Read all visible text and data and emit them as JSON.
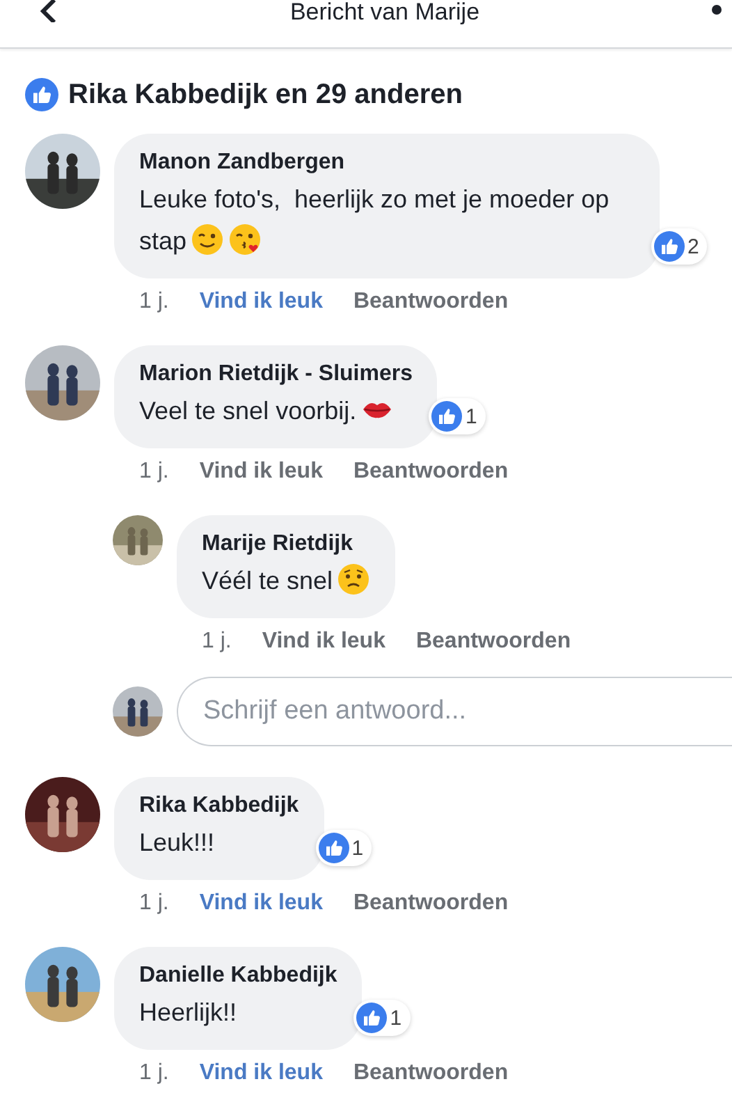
{
  "header": {
    "title": "Bericht van Marije"
  },
  "likes_summary": {
    "text": "Rika Kabbedijk en 29 anderen"
  },
  "comments": [
    {
      "author": "Manon Zandbergen",
      "text": "Leuke foto's,  heerlijk zo met je moeder op stap",
      "emojis": [
        {
          "kind": "wink"
        },
        {
          "kind": "kiss"
        }
      ],
      "reactions": "2",
      "time": "1 j.",
      "like_label": "Vind ik leuk",
      "liked": true,
      "reply_label": "Beantwoorden"
    },
    {
      "author": "Marion Rietdijk - Sluimers",
      "text": "Veel te snel voorbij.",
      "emojis": [
        {
          "kind": "lips"
        }
      ],
      "reactions": "1",
      "time": "1 j.",
      "like_label": "Vind ik leuk",
      "liked": false,
      "reply_label": "Beantwoorden",
      "replies": [
        {
          "author": "Marije Rietdijk",
          "text": "Véél te snel",
          "emojis": [
            {
              "kind": "worried"
            }
          ],
          "time": "1 j.",
          "like_label": "Vind ik leuk",
          "liked": false,
          "reply_label": "Beantwoorden"
        }
      ],
      "reply_field": {
        "placeholder": "Schrijf een antwoord..."
      }
    },
    {
      "author": "Rika Kabbedijk",
      "text": "Leuk!!!",
      "reactions": "1",
      "time": "1 j.",
      "like_label": "Vind ik leuk",
      "liked": true,
      "reply_label": "Beantwoorden"
    },
    {
      "author": "Danielle Kabbedijk",
      "text": "Heerlijk!!",
      "reactions": "1",
      "time": "1 j.",
      "like_label": "Vind ik leuk",
      "liked": true,
      "reply_label": "Beantwoorden"
    }
  ]
}
